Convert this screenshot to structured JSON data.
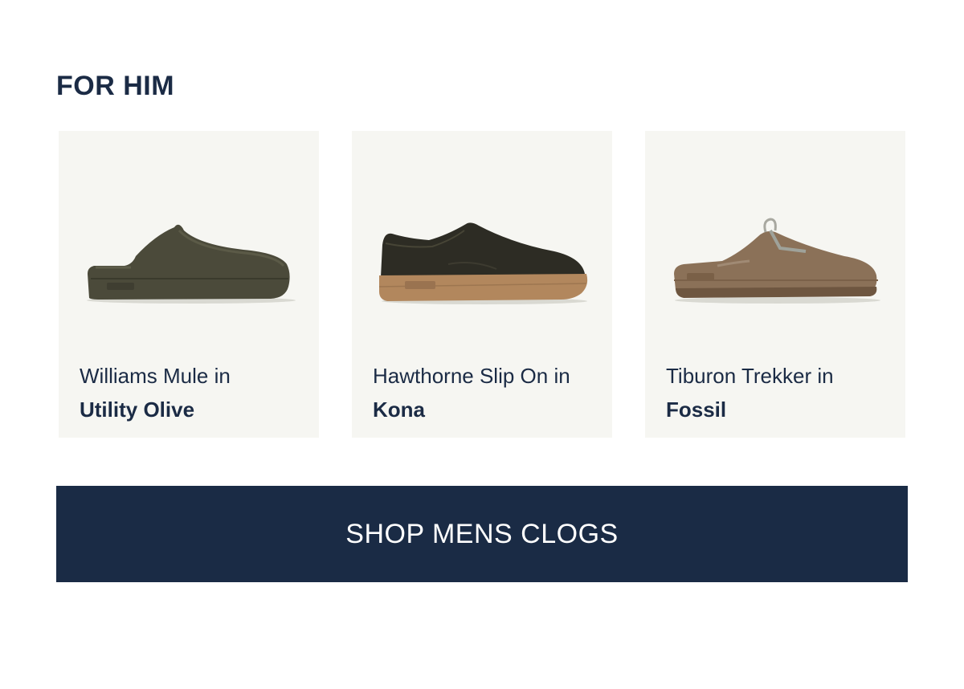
{
  "section": {
    "title": "FOR HIM"
  },
  "products": [
    {
      "name": "Williams Mule in",
      "color": "Utility Olive",
      "image_icon": "mule-shoe-image"
    },
    {
      "name": "Hawthorne Slip On in",
      "color": "Kona",
      "image_icon": "slip-on-shoe-image"
    },
    {
      "name": "Tiburon Trekker in",
      "color": "Fossil",
      "image_icon": "clog-shoe-image"
    }
  ],
  "cta": {
    "label": "SHOP MENS CLOGS"
  },
  "colors": {
    "navy": "#1a2b45",
    "card_bg": "#f6f6f2",
    "olive": "#4a4a39",
    "kona_upper": "#2c2b24",
    "gum_sole": "#b0865c",
    "fossil": "#8a7058"
  }
}
